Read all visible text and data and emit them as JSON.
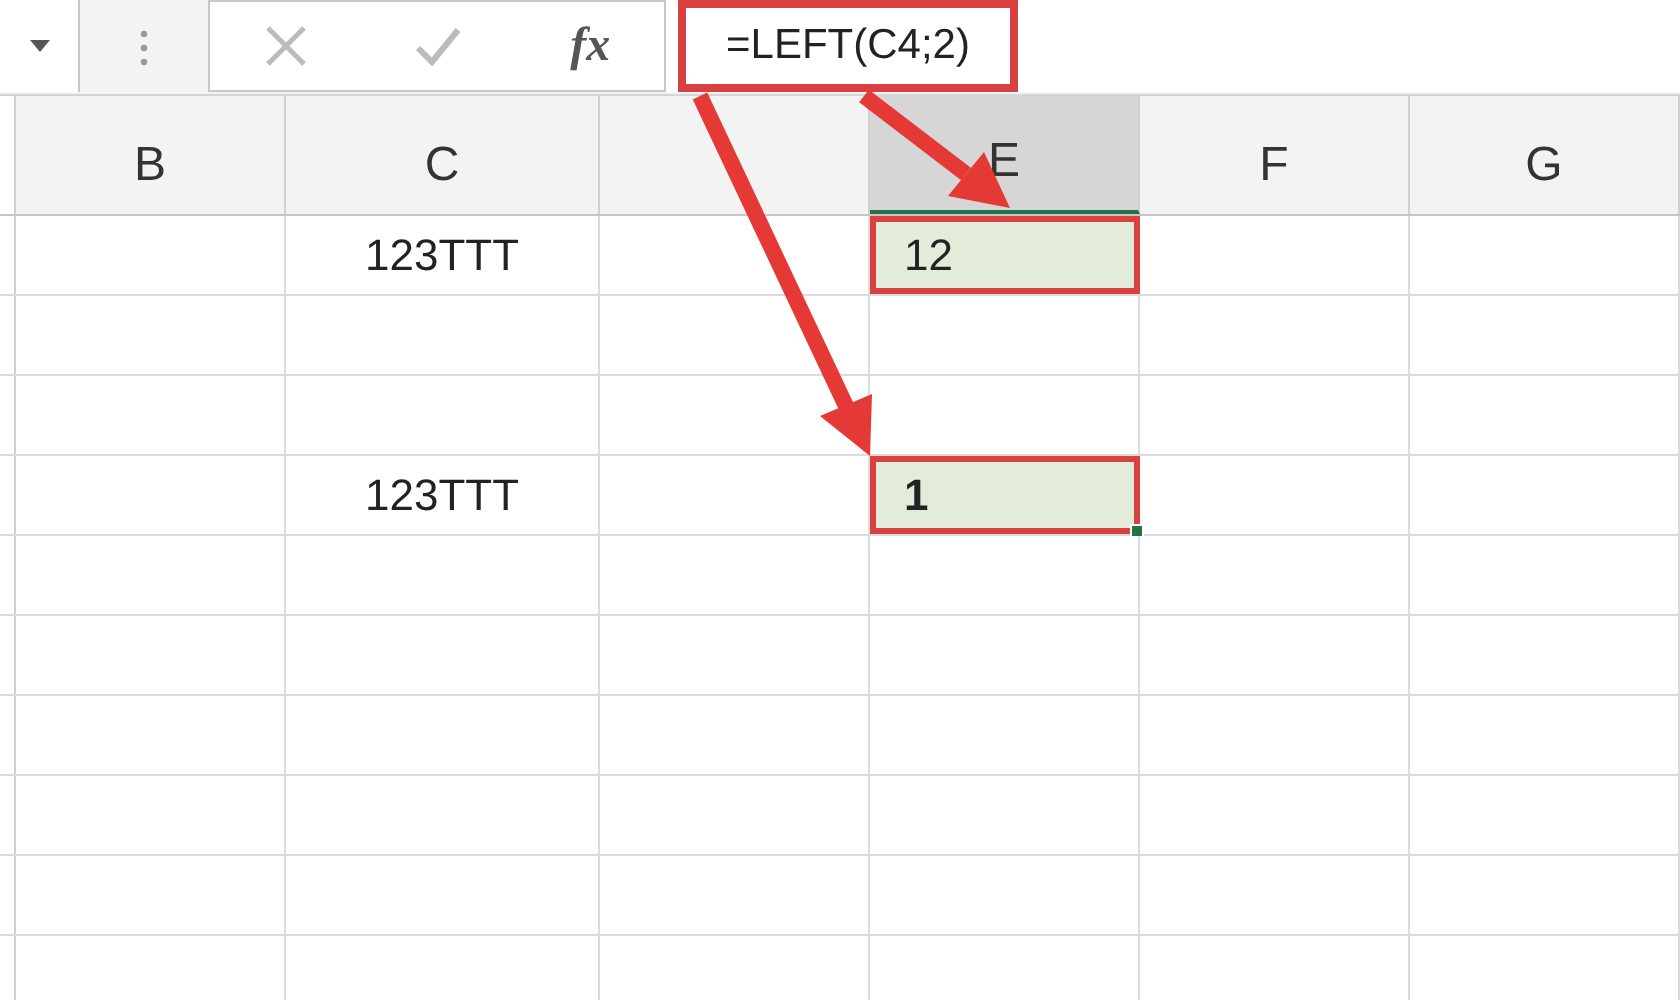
{
  "formula_bar": {
    "function_label": "fx",
    "formula": "=LEFT(C4;2)",
    "formula_boxed": true
  },
  "columns": [
    {
      "label": "B",
      "selected": false
    },
    {
      "label": "C",
      "selected": false
    },
    {
      "selected": false
    },
    {
      "label": "E",
      "selected": true
    },
    {
      "label": "F",
      "selected": false
    },
    {
      "label": "G",
      "selected": false
    }
  ],
  "rows": [
    {
      "cells": {
        "C": {
          "text": "123TTT"
        },
        "E": {
          "text": "12",
          "highlighted": true,
          "boxed": true,
          "selected": false
        }
      }
    },
    {
      "cells": {}
    },
    {
      "cells": {}
    },
    {
      "cells": {
        "C": {
          "text": "123TTT"
        },
        "E": {
          "text": "1",
          "highlighted": true,
          "boxed": true,
          "selected": true
        }
      }
    },
    {
      "cells": {}
    },
    {
      "cells": {}
    },
    {
      "cells": {}
    },
    {
      "cells": {}
    },
    {
      "cells": {}
    },
    {
      "cells": {}
    }
  ]
}
